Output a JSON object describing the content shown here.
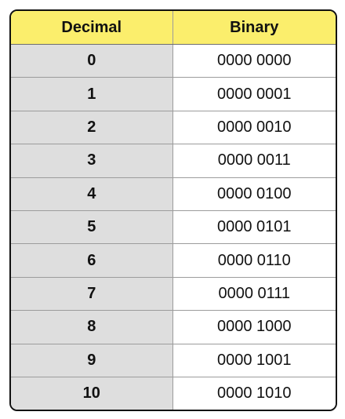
{
  "table": {
    "headers": [
      "Decimal",
      "Binary"
    ],
    "rows": [
      {
        "decimal": "0",
        "binary": "0000 0000"
      },
      {
        "decimal": "1",
        "binary": "0000 0001"
      },
      {
        "decimal": "2",
        "binary": "0000 0010"
      },
      {
        "decimal": "3",
        "binary": "0000 0011"
      },
      {
        "decimal": "4",
        "binary": "0000 0100"
      },
      {
        "decimal": "5",
        "binary": "0000 0101"
      },
      {
        "decimal": "6",
        "binary": "0000 0110"
      },
      {
        "decimal": "7",
        "binary": "0000 0111"
      },
      {
        "decimal": "8",
        "binary": "0000 1000"
      },
      {
        "decimal": "9",
        "binary": "0000 1001"
      },
      {
        "decimal": "10",
        "binary": "0000 1010"
      }
    ]
  },
  "colors": {
    "header_bg": "#fbee6c",
    "decimal_col_bg": "#dedede",
    "binary_col_bg": "#ffffff",
    "border": "#111111"
  }
}
